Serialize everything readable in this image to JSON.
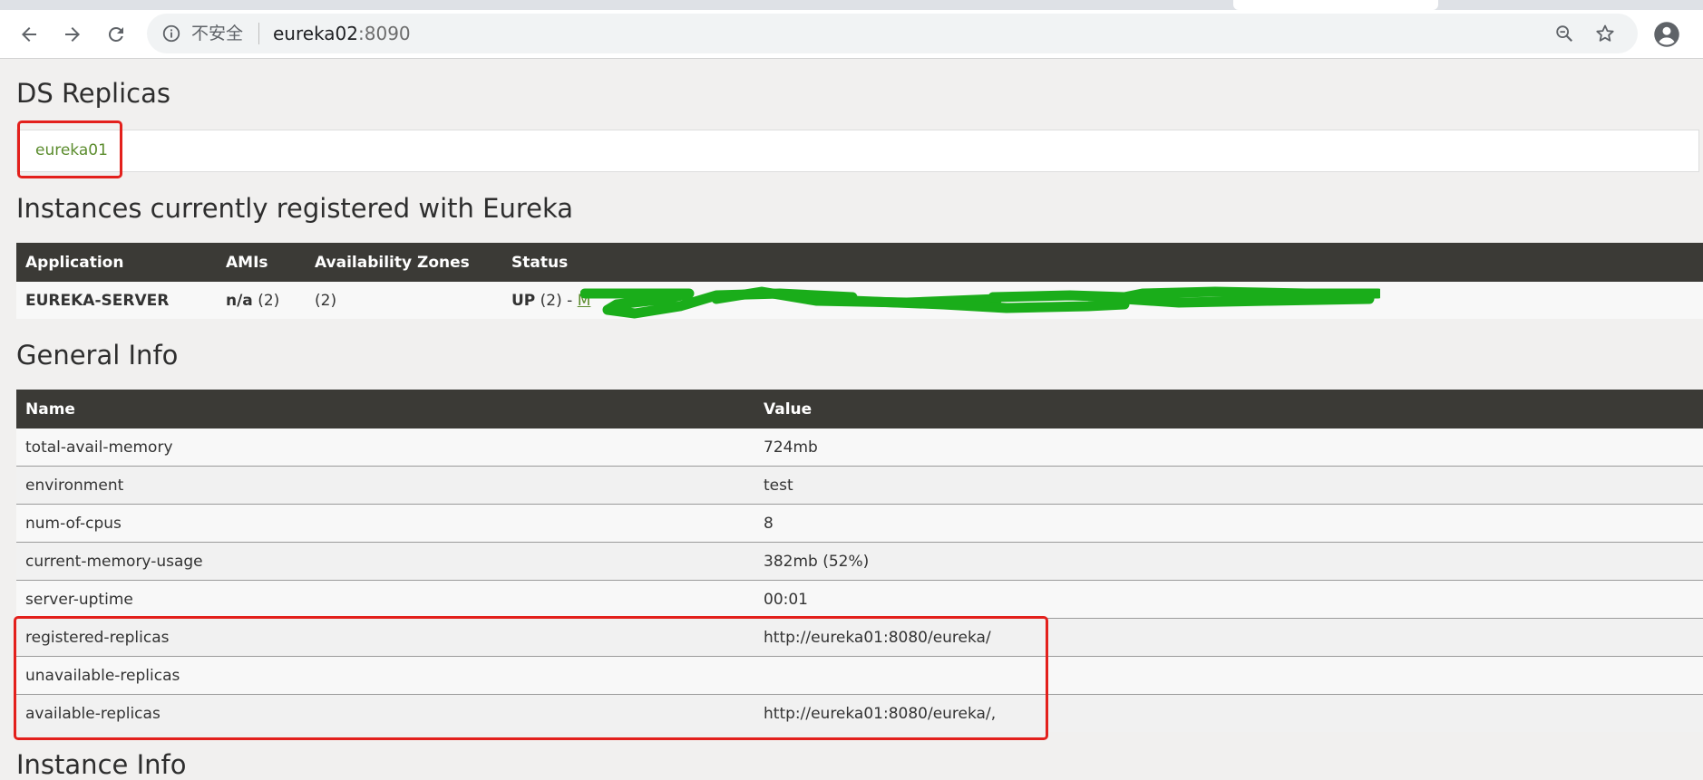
{
  "browser": {
    "security_label": "不安全",
    "url_host": "eureka02",
    "url_port": ":8090"
  },
  "icons": {
    "back": "back-arrow-icon",
    "forward": "forward-arrow-icon",
    "reload": "reload-icon",
    "info": "info-icon",
    "zoom": "zoom-icon",
    "bookmark": "star-icon",
    "profile": "account-icon"
  },
  "colors": {
    "header_bg": "#3b3a36",
    "link_green": "#5b8c2d",
    "highlight_red": "#e3201c",
    "scribble_green": "#1aad1a"
  },
  "ds_replicas": {
    "title": "DS Replicas",
    "items": [
      "eureka01"
    ]
  },
  "instances": {
    "title": "Instances currently registered with Eureka",
    "headers": [
      "Application",
      "AMIs",
      "Availability Zones",
      "Status"
    ],
    "rows": [
      {
        "application": "EUREKA-SERVER",
        "amis_bold": "n/a",
        "amis_count": " (2)",
        "zones": "(2)",
        "status_bold": "UP",
        "status_count": " (2) - ",
        "status_detail": "M"
      }
    ]
  },
  "general_info": {
    "title": "General Info",
    "headers": [
      "Name",
      "Value"
    ],
    "rows": [
      {
        "name": "total-avail-memory",
        "value": "724mb"
      },
      {
        "name": "environment",
        "value": "test"
      },
      {
        "name": "num-of-cpus",
        "value": "8"
      },
      {
        "name": "current-memory-usage",
        "value": "382mb (52%)"
      },
      {
        "name": "server-uptime",
        "value": "00:01"
      },
      {
        "name": "registered-replicas",
        "value": "http://eureka01:8080/eureka/"
      },
      {
        "name": "unavailable-replicas",
        "value": ""
      },
      {
        "name": "available-replicas",
        "value": "http://eureka01:8080/eureka/,"
      }
    ]
  },
  "next_section": {
    "title": "Instance Info"
  }
}
